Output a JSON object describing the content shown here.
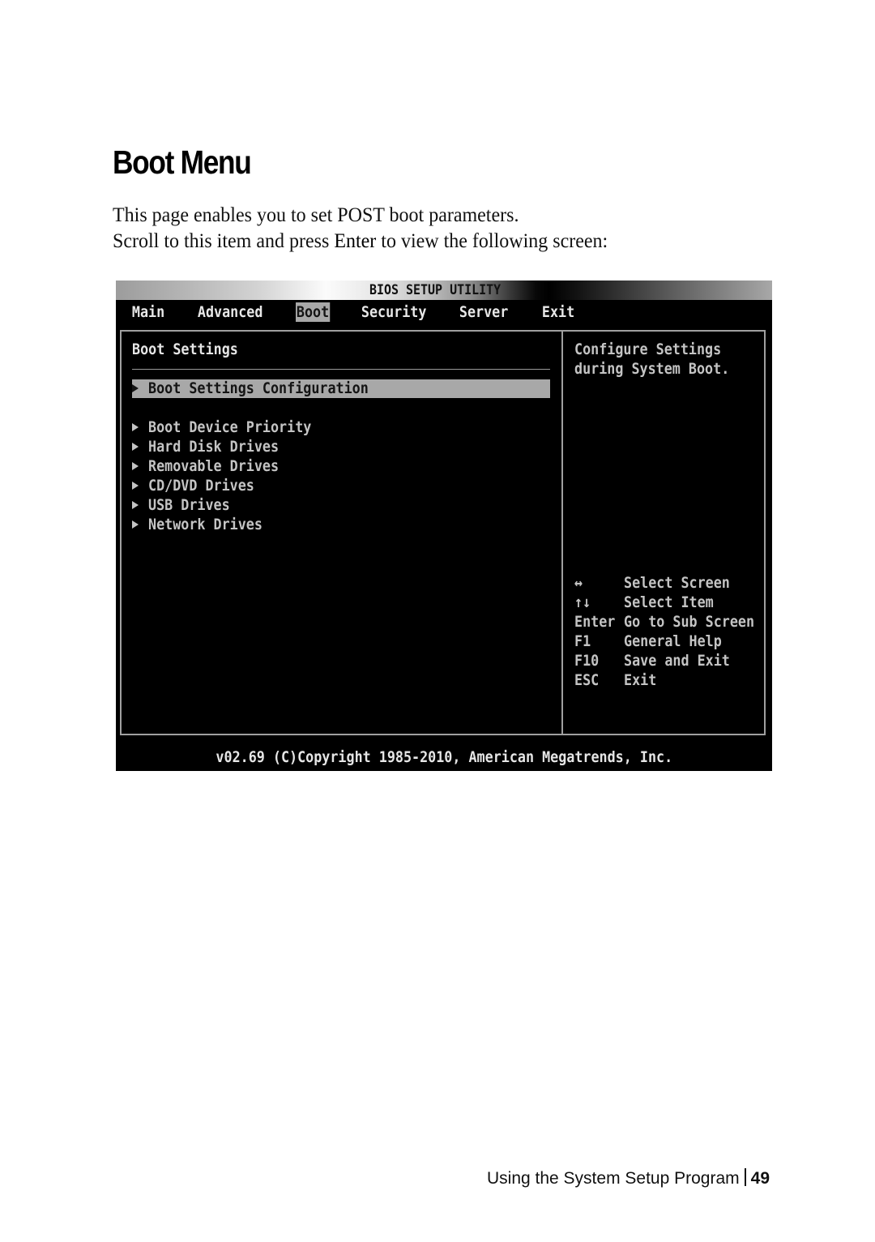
{
  "document": {
    "title": "Boot Menu",
    "intro_line1": "This page enables you to set POST boot parameters.",
    "intro_line2_pre": "Scroll to this item and press ",
    "intro_line2_key": "Enter",
    "intro_line2_post": " to view the following screen:",
    "footer_section": "Using the System Setup Program",
    "footer_page": "49"
  },
  "bios": {
    "title": "BIOS SETUP UTILITY",
    "menu": [
      {
        "label": "Main",
        "active": false
      },
      {
        "label": "Advanced",
        "active": false
      },
      {
        "label": "Boot",
        "active": true
      },
      {
        "label": "Security",
        "active": false
      },
      {
        "label": "Server",
        "active": false
      },
      {
        "label": "Exit",
        "active": false
      }
    ],
    "section_heading": "Boot Settings",
    "items": [
      {
        "label": "Boot Settings Configuration",
        "selected": true,
        "icon": "submenu-arrow-icon"
      },
      {
        "label": "Boot Device Priority",
        "selected": false,
        "icon": "submenu-arrow-icon"
      },
      {
        "label": "Hard Disk Drives",
        "selected": false,
        "icon": "submenu-arrow-icon"
      },
      {
        "label": "Removable Drives",
        "selected": false,
        "icon": "submenu-arrow-icon"
      },
      {
        "label": "CD/DVD Drives",
        "selected": false,
        "icon": "submenu-arrow-icon"
      },
      {
        "label": "USB Drives",
        "selected": false,
        "icon": "submenu-arrow-icon"
      },
      {
        "label": "Network Drives",
        "selected": false,
        "icon": "submenu-arrow-icon"
      }
    ],
    "help": {
      "line1": "Configure Settings",
      "line2": "during System Boot."
    },
    "keys": [
      {
        "key": "↔",
        "desc": "Select Screen"
      },
      {
        "key": "↑↓",
        "desc": "Select Item"
      },
      {
        "key": "Enter",
        "desc": "Go to Sub Screen"
      },
      {
        "key": "F1",
        "desc": "General Help"
      },
      {
        "key": "F10",
        "desc": "Save and Exit"
      },
      {
        "key": "ESC",
        "desc": "Exit"
      }
    ],
    "footer": "v02.69 (C)Copyright 1985-2010, American Megatrends, Inc.",
    "colors": {
      "background": "#000000",
      "text": "#c4c4c4",
      "highlight": "#a8a8a8",
      "border": "#a0a0a0"
    }
  }
}
